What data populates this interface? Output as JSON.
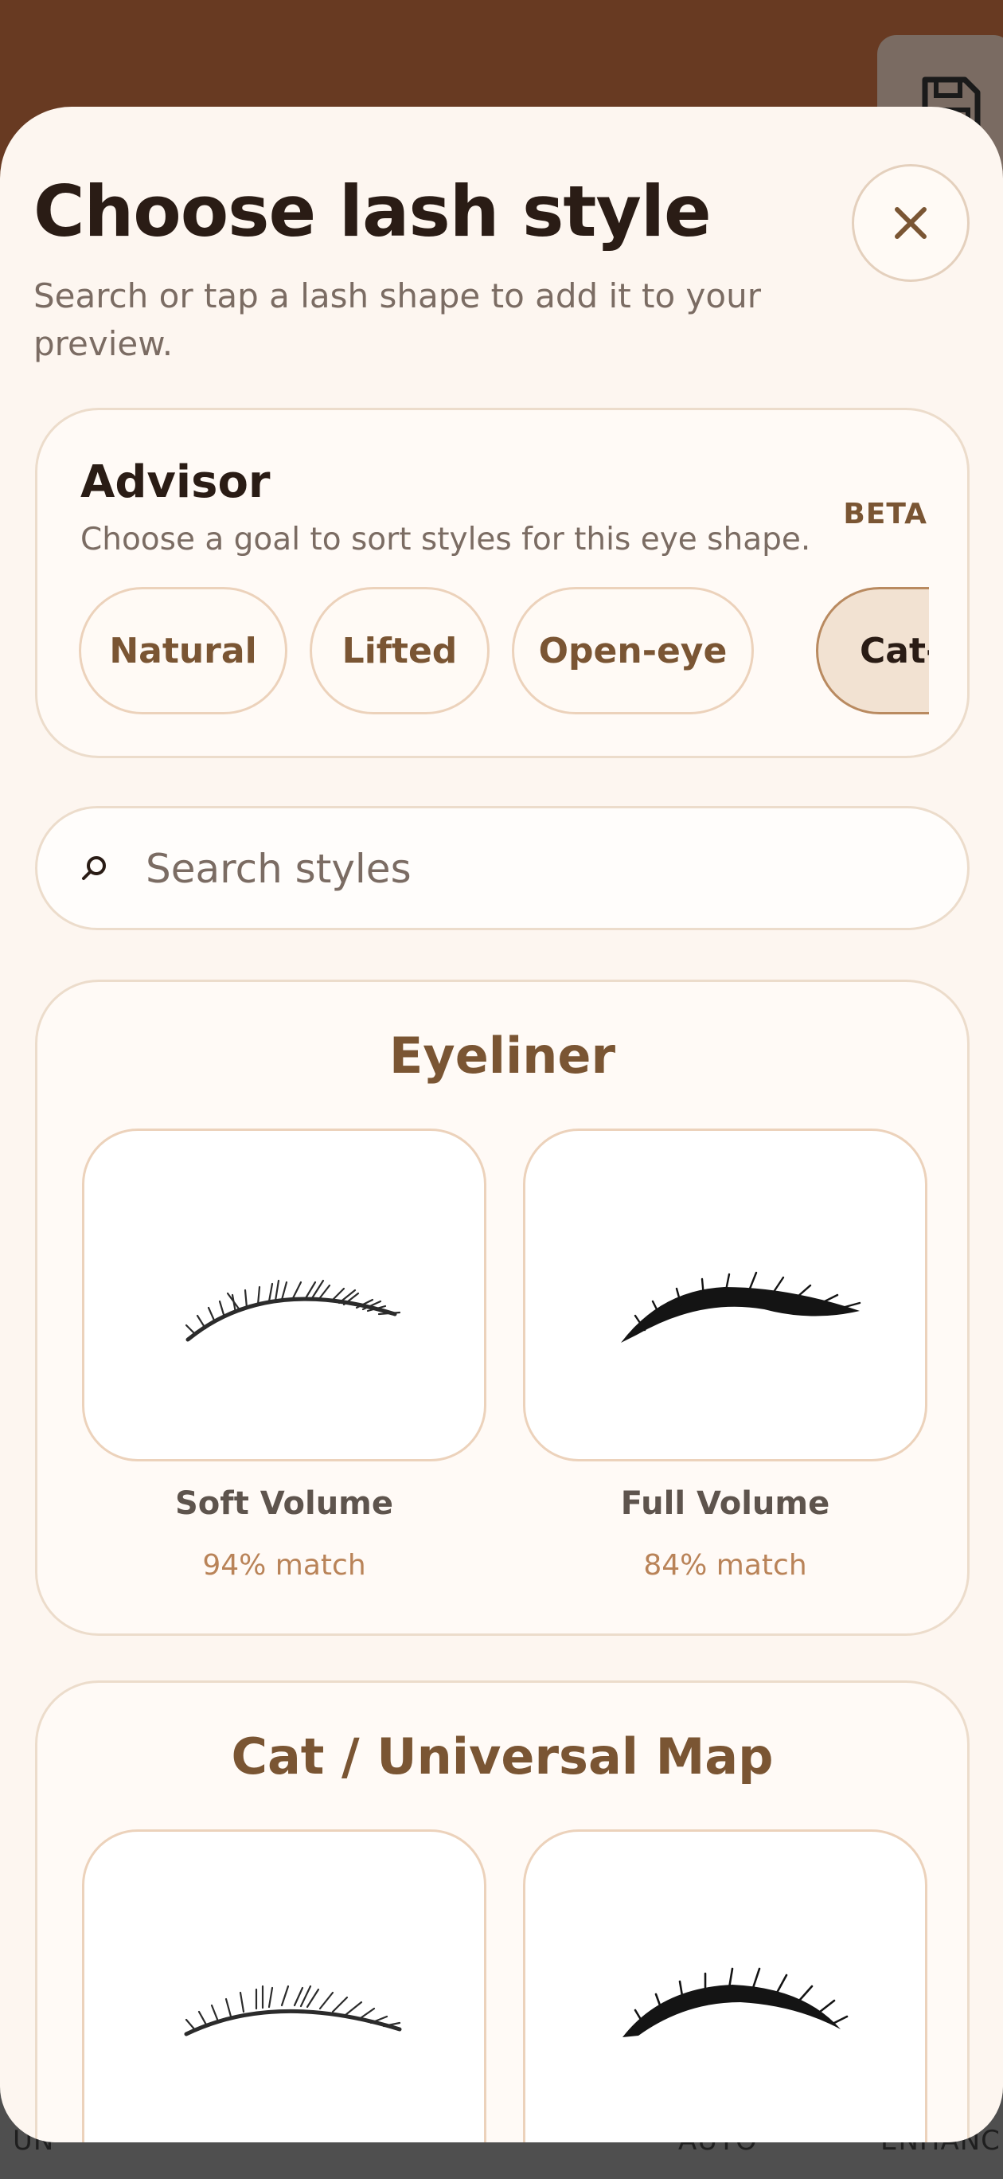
{
  "header": {
    "title": "Choose lash style",
    "subtitle": "Search or tap a lash shape to add it to your preview.",
    "close_icon": "close-icon"
  },
  "advisor": {
    "title": "Advisor",
    "badge": "BETA",
    "hint": "Choose a goal to sort styles for this eye shape.",
    "chips": [
      {
        "label": "Natural",
        "selected": false
      },
      {
        "label": "Lifted",
        "selected": false
      },
      {
        "label": "Open-eye",
        "selected": false
      },
      {
        "label": "Cat-eye",
        "selected": true
      }
    ]
  },
  "search": {
    "placeholder": "Search styles",
    "value": "",
    "icon": "search-icon"
  },
  "sections": [
    {
      "title": "Eyeliner",
      "items": [
        {
          "name": "Soft Volume",
          "match": "94% match"
        },
        {
          "name": "Full Volume",
          "match": "84% match"
        }
      ]
    },
    {
      "title": "Cat / Universal Map",
      "items": []
    }
  ],
  "background": {
    "bottom_labels": [
      "UN",
      "AUTO",
      "ENHANC"
    ],
    "save_icon": "save-icon"
  },
  "colors": {
    "accent": "#7a5533",
    "match": "#b98358",
    "sheet": "#fdf6f0",
    "app_bar": "#683a22"
  }
}
